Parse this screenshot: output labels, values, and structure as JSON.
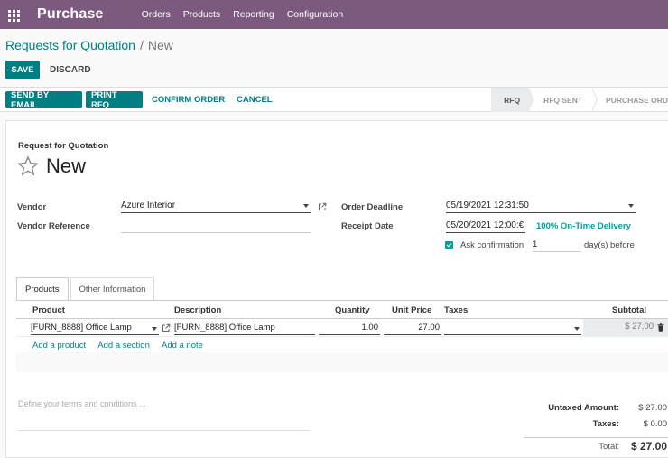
{
  "app": {
    "name": "Purchase"
  },
  "menu": [
    "Orders",
    "Products",
    "Reporting",
    "Configuration"
  ],
  "breadcrumb": {
    "parent": "Requests for Quotation",
    "separator": "/",
    "current": "New"
  },
  "toolbar": {
    "save": "SAVE",
    "discard": "DISCARD"
  },
  "statusbar": {
    "buttons": [
      "SEND BY EMAIL",
      "PRINT RFQ",
      "CONFIRM ORDER",
      "CANCEL"
    ],
    "steps": [
      "RFQ",
      "RFQ SENT",
      "PURCHASE ORD"
    ]
  },
  "form": {
    "title": "Request for Quotation",
    "name": "New",
    "vendor_label": "Vendor",
    "vendor_value": "Azure Interior",
    "vendor_ref_label": "Vendor Reference",
    "vendor_ref_value": "",
    "order_deadline_label": "Order Deadline",
    "order_deadline_value": "05/19/2021 12:31:50",
    "receipt_date_label": "Receipt Date",
    "receipt_date_value": "05/20/2021 12:00:€",
    "on_time": "100% On-Time Delivery",
    "ask_confirmation_label": "Ask confirmation",
    "ask_confirmation_checked": true,
    "ask_days": "1",
    "days_before": "day(s) before"
  },
  "tabs": [
    "Products",
    "Other Information"
  ],
  "table": {
    "headers": {
      "product": "Product",
      "description": "Description",
      "quantity": "Quantity",
      "unit_price": "Unit Price",
      "taxes": "Taxes",
      "subtotal": "Subtotal"
    },
    "rows": [
      {
        "product": "[FURN_8888] Office Lamp",
        "description": "[FURN_8888] Office Lamp",
        "quantity": "1.00",
        "unit_price": "27.00",
        "taxes": "",
        "subtotal": "$ 27.00"
      }
    ],
    "add_links": [
      "Add a product",
      "Add a section",
      "Add a note"
    ]
  },
  "terms_placeholder": "Define your terms and conditions ...",
  "totals": {
    "untaxed_label": "Untaxed Amount:",
    "untaxed_value": "$ 27.00",
    "taxes_label": "Taxes:",
    "taxes_value": "$ 0.00",
    "total_label": "Total:",
    "total_value": "$ 27.00"
  },
  "colors": {
    "topbar": "#7c5a80",
    "primary": "#017e84",
    "accent": "#00a09d"
  }
}
